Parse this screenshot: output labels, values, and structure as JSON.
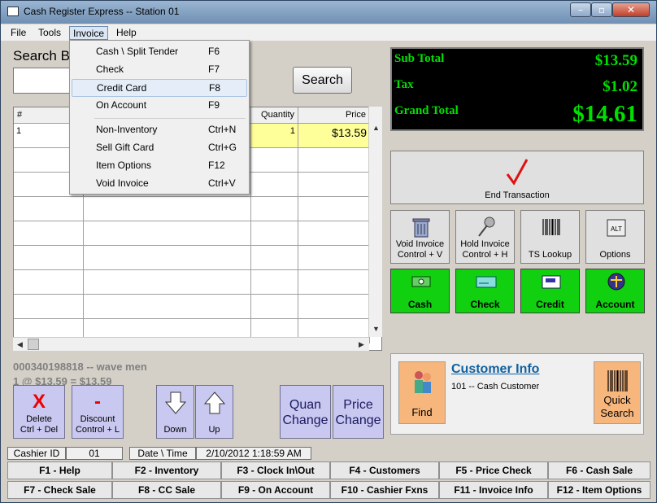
{
  "title_bar": {
    "title": "Cash Register Express -- Station 01",
    "min": "–",
    "max": "▫",
    "close": "✕"
  },
  "menu": [
    "File",
    "Tools",
    "Invoice",
    "Help"
  ],
  "search": {
    "label": "Search By",
    "button": "Search"
  },
  "grid": {
    "headers": [
      "#",
      "",
      "Quantity",
      "Price"
    ],
    "rows": [
      {
        "num": "1",
        "qty": "1",
        "price": "$13.59"
      }
    ]
  },
  "invoice_menu": [
    {
      "label": "Cash \\ Split Tender",
      "shortcut": "F6"
    },
    {
      "label": "Check",
      "shortcut": "F7"
    },
    {
      "label": "Credit Card",
      "shortcut": "F8"
    },
    {
      "label": "On Account",
      "shortcut": "F9"
    },
    {
      "label": "Non-Inventory",
      "shortcut": "Ctrl+N"
    },
    {
      "label": "Sell Gift Card",
      "shortcut": "Ctrl+G"
    },
    {
      "label": "Item Options",
      "shortcut": "F12"
    },
    {
      "label": "Void Invoice",
      "shortcut": "Ctrl+V"
    }
  ],
  "totals": {
    "sub_total_label": "Sub Total",
    "sub_total": "$13.59",
    "tax_label": "Tax",
    "tax": "$1.02",
    "grand_total_label": "Grand Total",
    "grand_total": "$14.61"
  },
  "actions": {
    "end_transaction": "End Transaction",
    "void_invoice": [
      "Void Invoice",
      "Control + V"
    ],
    "hold_invoice": [
      "Hold Invoice",
      "Control + H"
    ],
    "ts_lookup": "TS Lookup",
    "options": "Options",
    "cash": "Cash",
    "check": "Check",
    "credit": "Credit",
    "account": "Account"
  },
  "customer": {
    "title": "Customer Info",
    "line": "101 -- Cash Customer",
    "find": "Find",
    "quick_search": [
      "Quick",
      "Search"
    ]
  },
  "item_info": {
    "line1": "000340198818 -- wave men",
    "line2": "1 @ $13.59 = $13.59"
  },
  "bottom_buttons": {
    "delete": [
      "Delete",
      "Ctrl + Del"
    ],
    "discount": [
      "Discount",
      "Control + L"
    ],
    "down": "Down",
    "up": "Up",
    "quan_change": [
      "Quan",
      "Change"
    ],
    "price_change": [
      "Price",
      "Change"
    ]
  },
  "status": {
    "cashier_label": "Cashier ID",
    "cashier_id": "01",
    "datetime_label": "Date \\ Time",
    "datetime": "2/10/2012 1:18:59 AM"
  },
  "fkeys": [
    [
      "F1 - Help",
      "F2 - Inventory",
      "F3 - Clock In\\Out",
      "F4 - Customers",
      "F5 - Price Check",
      "F6 - Cash Sale"
    ],
    [
      "F7 - Check Sale",
      "F8 - CC Sale",
      "F9 - On Account",
      "F10 - Cashier Fxns",
      "F11 - Invoice Info",
      "F12 - Item Options"
    ]
  ],
  "colors": {
    "totals_text": "#00e000",
    "green_button": "#10d010",
    "highlight_row": "#ffff99"
  }
}
